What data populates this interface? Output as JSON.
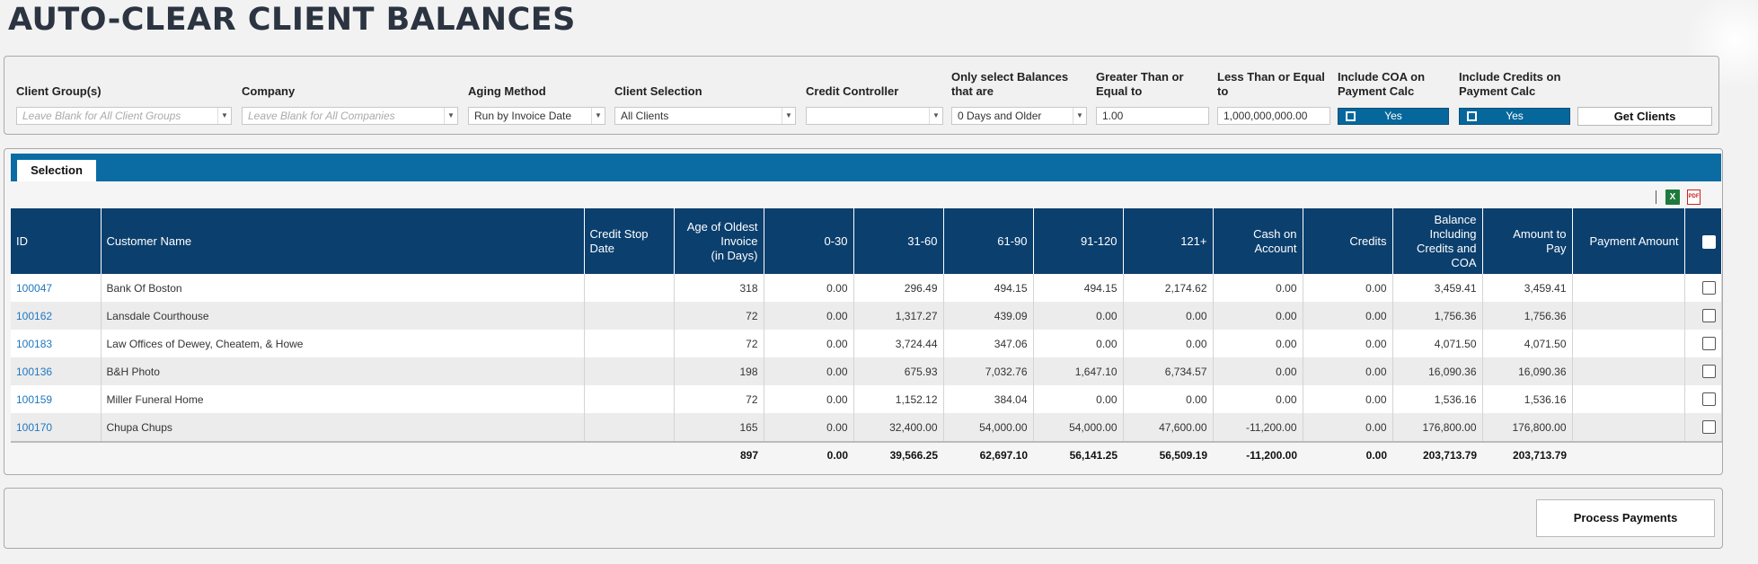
{
  "page": {
    "title": "AUTO-CLEAR CLIENT BALANCES"
  },
  "filters": {
    "client_groups": {
      "label": "Client Group(s)",
      "placeholder": "Leave Blank for All Client Groups"
    },
    "company": {
      "label": "Company",
      "placeholder": "Leave Blank for All Companies"
    },
    "aging_method": {
      "label": "Aging Method",
      "value": "Run by Invoice Date"
    },
    "client_selection": {
      "label": "Client Selection",
      "value": "All Clients"
    },
    "credit_controller": {
      "label": "Credit Controller",
      "value": ""
    },
    "only_select": {
      "label_1": "Only select Balances",
      "label_2": "that are",
      "value": "0 Days and Older"
    },
    "greater_than": {
      "label_1": "Greater Than or",
      "label_2": "Equal to",
      "value": "1.00"
    },
    "less_than": {
      "label_1": "Less Than or Equal",
      "label_2": "to",
      "value": "1,000,000,000.00"
    },
    "include_coa": {
      "label_1": "Include COA on",
      "label_2": "Payment Calc",
      "value": "Yes"
    },
    "include_credits": {
      "label_1": "Include Credits on",
      "label_2": "Payment Calc",
      "value": "Yes"
    },
    "get_clients_label": "Get Clients"
  },
  "tabs": [
    {
      "label": "Selection"
    }
  ],
  "grid": {
    "headers": {
      "id": "ID",
      "customer_name": "Customer Name",
      "credit_stop_1": "Credit Stop",
      "credit_stop_2": "Date",
      "age_1": "Age of Oldest",
      "age_2": "Invoice",
      "age_3": "(in Days)",
      "b0_30": "0-30",
      "b31_60": "31-60",
      "b61_90": "61-90",
      "b91_120": "91-120",
      "b121": "121+",
      "cash_1": "Cash on",
      "cash_2": "Account",
      "credits": "Credits",
      "bal_1": "Balance",
      "bal_2": "Including",
      "bal_3": "Credits and",
      "bal_4": "COA",
      "amt_1": "Amount to",
      "amt_2": "Pay",
      "payment_amount": "Payment Amount"
    },
    "rows": [
      {
        "id": "100047",
        "name": "Bank Of Boston",
        "stop": "",
        "age": "318",
        "b0_30": "0.00",
        "b31_60": "296.49",
        "b61_90": "494.15",
        "b91_120": "494.15",
        "b121": "2,174.62",
        "cash": "0.00",
        "credits": "0.00",
        "balance": "3,459.41",
        "amount": "3,459.41",
        "payment": ""
      },
      {
        "id": "100162",
        "name": "Lansdale Courthouse",
        "stop": "",
        "age": "72",
        "b0_30": "0.00",
        "b31_60": "1,317.27",
        "b61_90": "439.09",
        "b91_120": "0.00",
        "b121": "0.00",
        "cash": "0.00",
        "credits": "0.00",
        "balance": "1,756.36",
        "amount": "1,756.36",
        "payment": ""
      },
      {
        "id": "100183",
        "name": "Law Offices of Dewey, Cheatem, & Howe",
        "stop": "",
        "age": "72",
        "b0_30": "0.00",
        "b31_60": "3,724.44",
        "b61_90": "347.06",
        "b91_120": "0.00",
        "b121": "0.00",
        "cash": "0.00",
        "credits": "0.00",
        "balance": "4,071.50",
        "amount": "4,071.50",
        "payment": ""
      },
      {
        "id": "100136",
        "name": "B&H Photo",
        "stop": "",
        "age": "198",
        "b0_30": "0.00",
        "b31_60": "675.93",
        "b61_90": "7,032.76",
        "b91_120": "1,647.10",
        "b121": "6,734.57",
        "cash": "0.00",
        "credits": "0.00",
        "balance": "16,090.36",
        "amount": "16,090.36",
        "payment": ""
      },
      {
        "id": "100159",
        "name": "Miller Funeral Home",
        "stop": "",
        "age": "72",
        "b0_30": "0.00",
        "b31_60": "1,152.12",
        "b61_90": "384.04",
        "b91_120": "0.00",
        "b121": "0.00",
        "cash": "0.00",
        "credits": "0.00",
        "balance": "1,536.16",
        "amount": "1,536.16",
        "payment": ""
      },
      {
        "id": "100170",
        "name": "Chupa Chups",
        "stop": "",
        "age": "165",
        "b0_30": "0.00",
        "b31_60": "32,400.00",
        "b61_90": "54,000.00",
        "b91_120": "54,000.00",
        "b121": "47,600.00",
        "cash": "-11,200.00",
        "credits": "0.00",
        "balance": "176,800.00",
        "amount": "176,800.00",
        "payment": ""
      }
    ],
    "totals": {
      "age": "897",
      "b0_30": "0.00",
      "b31_60": "39,566.25",
      "b61_90": "62,697.10",
      "b91_120": "56,141.25",
      "b121": "56,509.19",
      "cash": "-11,200.00",
      "credits": "0.00",
      "balance": "203,713.79",
      "amount": "203,713.79"
    }
  },
  "icons": {
    "excel": "excel-export-icon",
    "pdf": "pdf-export-icon"
  },
  "excel_glyph": "X",
  "pdf_glyph": "PDF",
  "actions": {
    "process_payments_label": "Process Payments"
  }
}
